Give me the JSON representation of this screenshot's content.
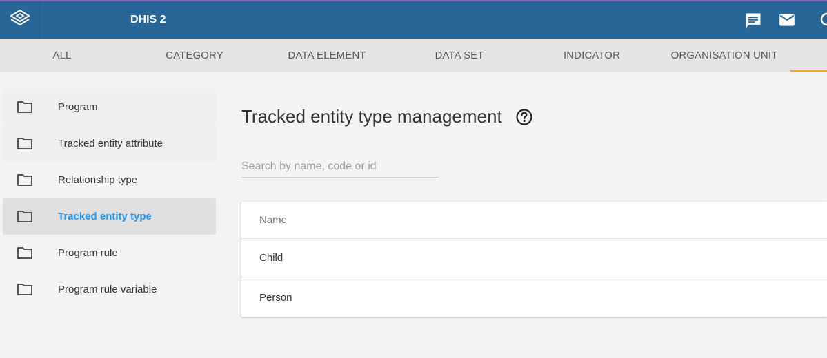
{
  "header": {
    "app_title": "DHIS 2",
    "logo_icon": "dhis2-layers-icon",
    "icons": [
      "message-icon",
      "mail-icon",
      "profile-icon"
    ],
    "background": "#276696"
  },
  "tabs": [
    "ALL",
    "CATEGORY",
    "DATA ELEMENT",
    "DATA SET",
    "INDICATOR",
    "ORGANISATION UNIT"
  ],
  "sidebar": {
    "items": [
      {
        "label": "Program"
      },
      {
        "label": "Tracked entity attribute"
      },
      {
        "label": "Relationship type"
      },
      {
        "label": "Tracked entity type",
        "active": true
      },
      {
        "label": "Program rule"
      },
      {
        "label": "Program rule variable"
      }
    ]
  },
  "main": {
    "title": "Tracked entity type management",
    "search_placeholder": "Search by name, code or id",
    "table": {
      "header": "Name",
      "rows": [
        "Child",
        "Person"
      ]
    }
  },
  "colors": {
    "accent": "#2196f3",
    "tab_indicator": "#f5a623"
  }
}
